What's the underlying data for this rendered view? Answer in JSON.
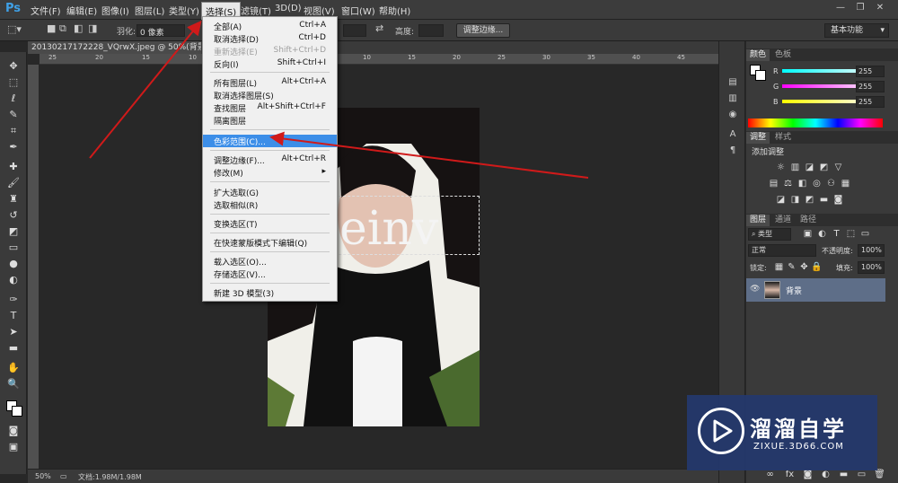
{
  "app": {
    "logo": "Ps"
  },
  "menubar": {
    "items": [
      "文件(F)",
      "编辑(E)",
      "图像(I)",
      "图层(L)",
      "类型(Y)",
      "选择(S)",
      "滤镜(T)",
      "3D(D)",
      "视图(V)",
      "窗口(W)",
      "帮助(H)"
    ]
  },
  "window_controls": {
    "minimize": "—",
    "restore": "❐",
    "close": "✕"
  },
  "options": {
    "feather_label": "羽化:",
    "feather_value": "0 像素",
    "height_label": "高度:",
    "refine_edge": "调整边缘...",
    "workspace": "基本功能"
  },
  "document": {
    "tab_title": "20130217172228_VQrwX.jpeg @ 50%(背景, RGB/8)",
    "ruler_ticks": [
      "25",
      "20",
      "15",
      "10",
      "5",
      "0",
      "5",
      "10",
      "15",
      "20",
      "25",
      "30",
      "35",
      "40",
      "45"
    ],
    "image_text": "einv",
    "zoom": "50%",
    "doc_size": "文档:1.98M/1.98M"
  },
  "select_menu": {
    "items": [
      {
        "label": "全部(A)",
        "shortcut": "Ctrl+A",
        "disabled": false
      },
      {
        "label": "取消选择(D)",
        "shortcut": "Ctrl+D",
        "disabled": false
      },
      {
        "label": "重新选择(E)",
        "shortcut": "Shift+Ctrl+D",
        "disabled": true
      },
      {
        "label": "反向(I)",
        "shortcut": "Shift+Ctrl+I",
        "disabled": false
      },
      {
        "label": "所有图层(L)",
        "shortcut": "Alt+Ctrl+A",
        "disabled": false
      },
      {
        "label": "取消选择图层(S)",
        "shortcut": "",
        "disabled": false
      },
      {
        "label": "查找图层",
        "shortcut": "Alt+Shift+Ctrl+F",
        "disabled": false
      },
      {
        "label": "隔离图层",
        "shortcut": "",
        "disabled": false
      },
      {
        "label": "色彩范围(C)...",
        "shortcut": "",
        "disabled": false,
        "highlight": true
      },
      {
        "label": "调整边缘(F)...",
        "shortcut": "Alt+Ctrl+R",
        "disabled": false
      },
      {
        "label": "修改(M)",
        "shortcut": "▸",
        "disabled": false
      },
      {
        "label": "扩大选取(G)",
        "shortcut": "",
        "disabled": false
      },
      {
        "label": "选取相似(R)",
        "shortcut": "",
        "disabled": false
      },
      {
        "label": "变换选区(T)",
        "shortcut": "",
        "disabled": false
      },
      {
        "label": "在快速蒙版模式下编辑(Q)",
        "shortcut": "",
        "disabled": false
      },
      {
        "label": "载入选区(O)...",
        "shortcut": "",
        "disabled": false
      },
      {
        "label": "存储选区(V)...",
        "shortcut": "",
        "disabled": false
      },
      {
        "label": "新建 3D 模型(3)",
        "shortcut": "",
        "disabled": false
      }
    ]
  },
  "color_panel": {
    "tabs": [
      "颜色",
      "色板"
    ],
    "r_label": "R",
    "g_label": "G",
    "b_label": "B",
    "r_value": "255",
    "g_value": "255",
    "b_value": "255"
  },
  "adjust_panel": {
    "tabs": [
      "调整",
      "样式"
    ],
    "title": "添加调整"
  },
  "layers_panel": {
    "tabs": [
      "图层",
      "通道",
      "路径"
    ],
    "filter": "类型",
    "blend_mode": "正常",
    "opacity_label": "不透明度:",
    "opacity_value": "100%",
    "lock_label": "锁定:",
    "fill_label": "填充:",
    "fill_value": "100%",
    "layer_name": "背景"
  },
  "badge": {
    "title": "溜溜自学",
    "url": "ZIXUE.3D66.COM"
  },
  "colors": {
    "accent": "#3c8ee8",
    "badge_bg": "#24386e",
    "arrow": "#d01a1a"
  }
}
